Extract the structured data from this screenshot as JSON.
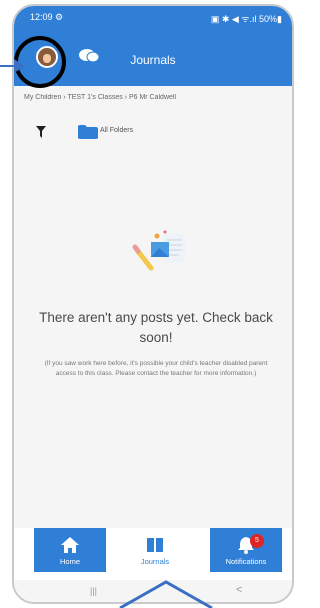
{
  "status_bar": {
    "time": "12:09 ⚙",
    "right": "▣ ✱ ◀ ᯤ.ıl 50%▮"
  },
  "header": {
    "title": "Journals"
  },
  "breadcrumb": "My Children  ›  TEST 1's Classes  ›  P6 Mr Caldwell",
  "filter_bar": {
    "folder_label": "All Folders"
  },
  "empty_state": {
    "title": "There aren't any posts yet. Check back soon!",
    "note": "(If you saw work here before, it's possible your child's teacher disabled parent access to this class. Please contact the teacher for more information.)"
  },
  "tabs": [
    {
      "label": "Home",
      "icon": "home-icon"
    },
    {
      "label": "Journals",
      "icon": "book-icon"
    },
    {
      "label": "Notifications",
      "icon": "bell-icon",
      "badge": "5"
    }
  ],
  "nav_bar": {
    "recents": "|||",
    "back": "<"
  },
  "colors": {
    "brand": "#2f7fd6",
    "badge": "#e02424",
    "annotation": "#3b6fc4"
  }
}
